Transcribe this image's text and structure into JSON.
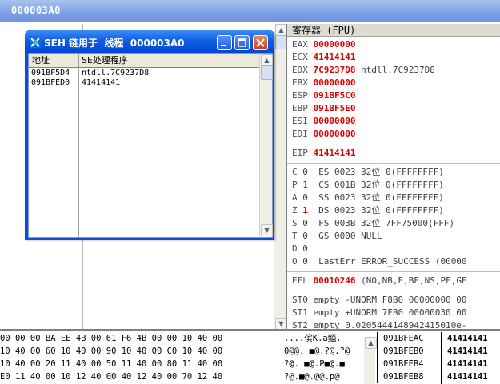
{
  "app": {
    "title": "000003A0"
  },
  "registers": {
    "header": "寄存器 (FPU)",
    "gprs": [
      {
        "name": "EAX",
        "value": "00000000",
        "comment": ""
      },
      {
        "name": "ECX",
        "value": "41414141",
        "comment": ""
      },
      {
        "name": "EDX",
        "value": "7C9237D8",
        "comment": "ntdll.7C9237D8"
      },
      {
        "name": "EBX",
        "value": "00000000",
        "comment": ""
      },
      {
        "name": "ESP",
        "value": "091BF5C0",
        "comment": ""
      },
      {
        "name": "EBP",
        "value": "091BF5E0",
        "comment": ""
      },
      {
        "name": "ESI",
        "value": "00000000",
        "comment": ""
      },
      {
        "name": "EDI",
        "value": "00000000",
        "comment": ""
      }
    ],
    "eip": {
      "name": "EIP",
      "value": "41414141"
    },
    "flags": [
      {
        "flag": "C",
        "val": "0",
        "seg": "ES 0023 32位 0(FFFFFFFF)",
        "highlight": false
      },
      {
        "flag": "P",
        "val": "1",
        "seg": "CS 001B 32位 0(FFFFFFFF)",
        "highlight": false
      },
      {
        "flag": "A",
        "val": "0",
        "seg": "SS 0023 32位 0(FFFFFFFF)",
        "highlight": false
      },
      {
        "flag": "Z",
        "val": "1",
        "seg": "DS 0023 32位 0(FFFFFFFF)",
        "highlight": true
      },
      {
        "flag": "S",
        "val": "0",
        "seg": "FS 003B 32位 7FF75000(FFF)",
        "highlight": false
      },
      {
        "flag": "T",
        "val": "0",
        "seg": "GS 0000 NULL",
        "highlight": false
      },
      {
        "flag": "D",
        "val": "0",
        "seg": "",
        "highlight": false
      },
      {
        "flag": "O",
        "val": "0",
        "seg": "LastErr ERROR_SUCCESS (00000",
        "highlight": false
      }
    ],
    "efl": {
      "name": "EFL",
      "value": "00010246",
      "comment": "(NO,NB,E,BE,NS,PE,GE"
    },
    "fpu": [
      "ST0 empty -UNORM F8B0 00000000 00",
      "ST1 empty +UNORM 7FB0 00000030 00",
      "ST2 empty 0.0205444148942415010e-"
    ]
  },
  "seh_window": {
    "title": "SEH 链用于  线程  000003A0",
    "col_address": "地址",
    "col_handler": "SE处理程序",
    "rows": [
      {
        "address": "091BF5D4",
        "handler": "ntdll.7C9237D8"
      },
      {
        "address": "091BFED0",
        "handler": "41414141"
      }
    ]
  },
  "dump": {
    "hex_rows": [
      "00 00 00 BA EE 4B 00 61 F6 4B 00 00 10 40 00",
      "10 40 00 60 10 40 00 90 10 40 00 C0 10 40 00",
      "10 40 00 20 11 40 00 50 11 40 00 80 11 40 00",
      "E0 11 40 00 10 12 40 00 40 12 40 00 70 12 40"
    ],
    "ascii_rows": [
      "....傧K.a鲻.",
      "0@@. ■@.?@.?@",
      "?@. ■@.P■@.■",
      "?@.■@.@@.p@"
    ]
  },
  "stack": {
    "rows": [
      {
        "address": "091BFEAC",
        "value": "41414141"
      },
      {
        "address": "091BFEB0",
        "value": "41414141"
      },
      {
        "address": "091BFEB4",
        "value": "41414141"
      },
      {
        "address": "091BFEB8",
        "value": "41414141"
      }
    ]
  },
  "colors": {
    "highlight_red": "#e00000",
    "titlebar_blue": "#0a4fd6"
  }
}
